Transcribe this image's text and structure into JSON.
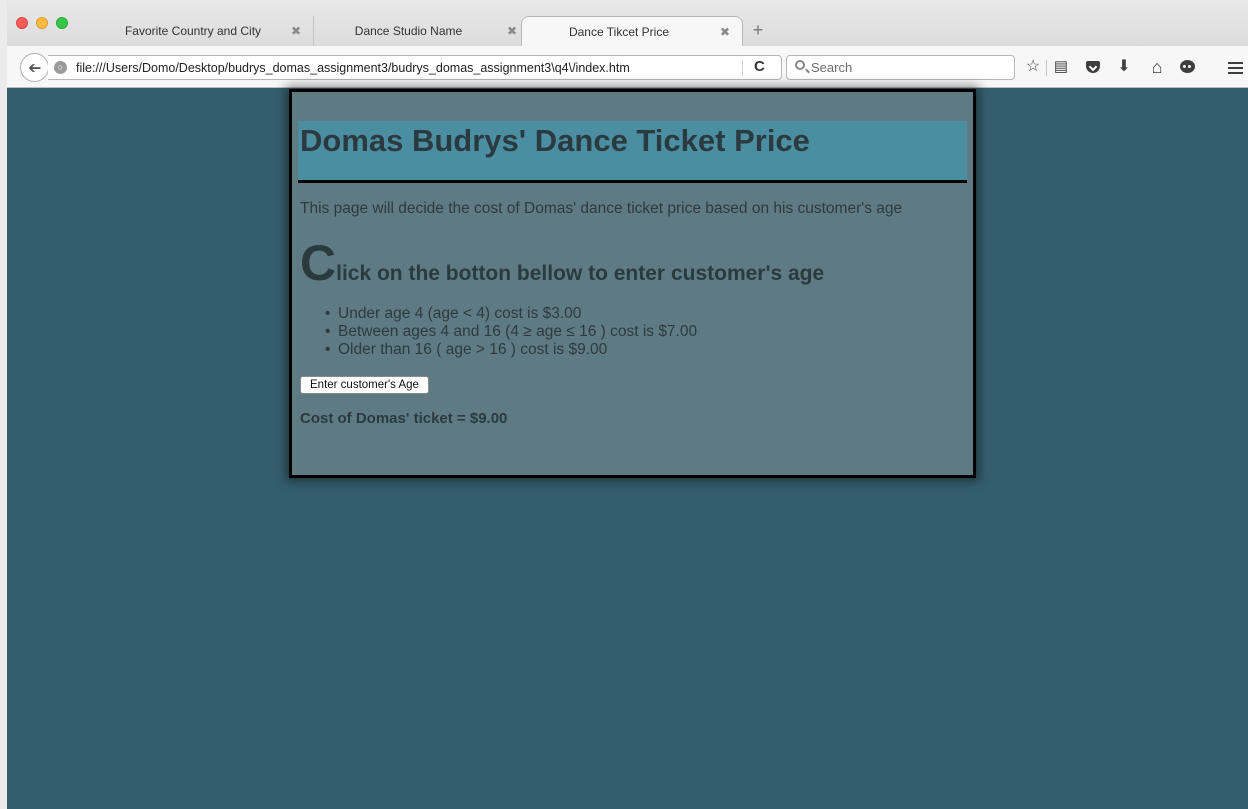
{
  "browser": {
    "tabs": [
      {
        "label": "Favorite Country and City",
        "close": "✖",
        "active": false
      },
      {
        "label": "Dance Studio Name",
        "close": "✖",
        "active": false
      },
      {
        "label": "Dance Tikcet Price",
        "close": "✖",
        "active": true
      }
    ],
    "new_tab": "+",
    "url": "file:///Users/Domo/Desktop/budrys_domas_assignment3/budrys_domas_assignment3\\q4\\/index.htm",
    "search_placeholder": "Search",
    "icons": [
      "back-arrow-icon",
      "globe-icon",
      "reload-icon",
      "search-icon",
      "bookmark-star-icon",
      "reading-list-icon",
      "pocket-icon",
      "download-icon",
      "home-icon",
      "chat-icon",
      "hamburger-menu-icon"
    ],
    "glyphs": {
      "back": "➔",
      "globe": "○",
      "reload": "C",
      "star": "☆",
      "reading_list": "▤",
      "download": "⬇",
      "home": "⌂"
    }
  },
  "page": {
    "title": "Domas Budrys' Dance Ticket Price",
    "intro": "This page will decide the cost of Domas' dance ticket price based on his customer's age",
    "instruction_first_letter": "C",
    "instruction_rest": "lick on the botton bellow to enter customer's age",
    "price_rules": [
      "Under age 4 (age < 4) cost is $3.00",
      "Between ages 4 and 16 (4 ≥ age ≤ 16 ) cost is $7.00",
      "Older than 16 ( age > 16 ) cost is $9.00"
    ],
    "button_label": "Enter customer's Age",
    "result": "Cost of Domas' ticket = $9.00"
  },
  "colors": {
    "page_background": "#345e6c",
    "content_box": "#5e7b84",
    "banner": "#4b8ea2",
    "heading_text": "#2b3a3f"
  }
}
